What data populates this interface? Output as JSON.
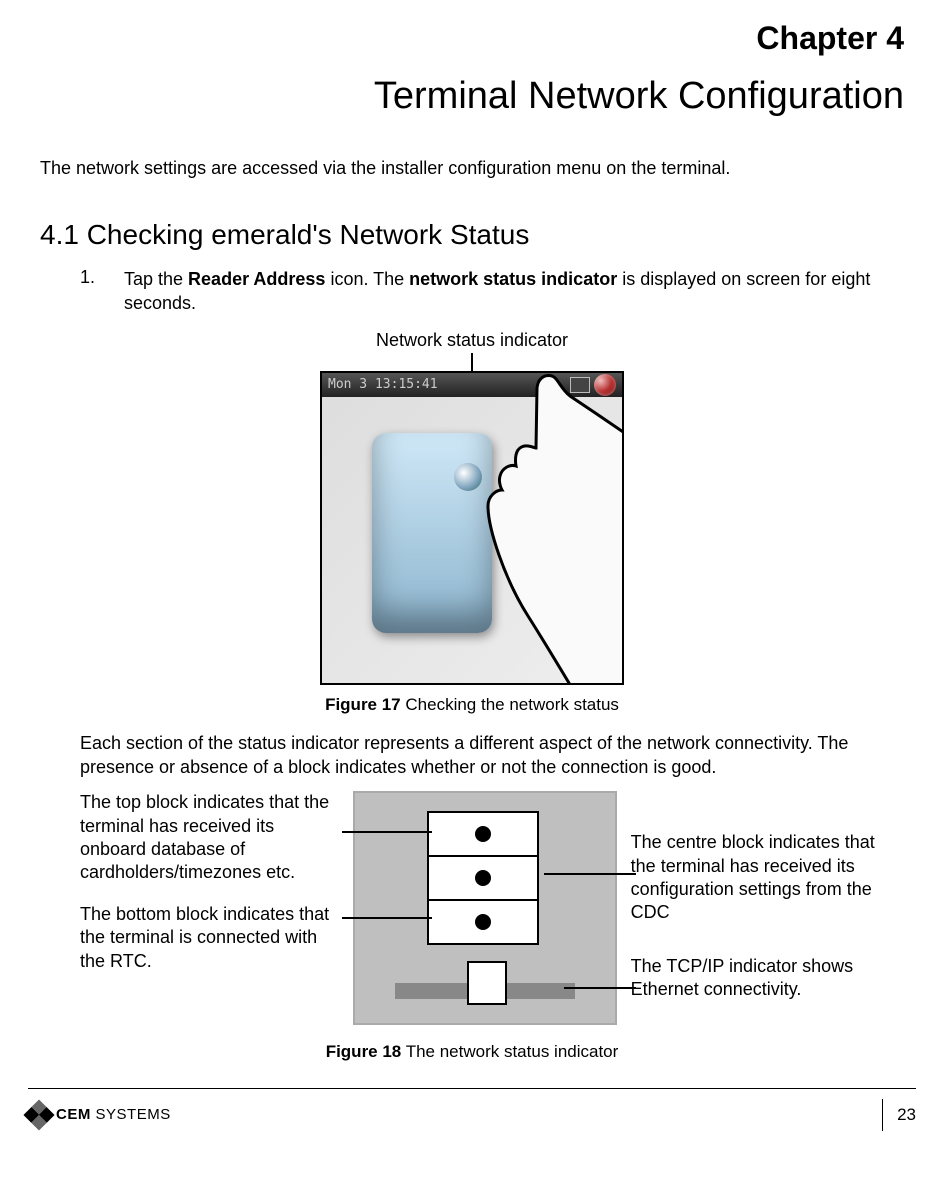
{
  "chapter_label": "Chapter 4",
  "chapter_title": "Terminal Network Configuration",
  "intro": "The network settings are accessed via the installer configuration menu on the terminal.",
  "section_heading": "4.1  Checking emerald's Network Status",
  "step1_num": "1.",
  "step1_a": "Tap the ",
  "step1_b": "Reader Address",
  "step1_c": " icon. The ",
  "step1_d": "network status indicator",
  "step1_e": " is displayed on screen for eight seconds.",
  "fig17_top_label": "Network status indicator",
  "status_time": "Mon 3   13:15:41",
  "fig17_caption_b": "Figure 17",
  "fig17_caption_t": " Checking the network status",
  "para2": "Each section of the status indicator represents a different aspect of the network connectivity. The presence or absence of a block indicates whether or not the connection is good.",
  "left_top": "The top block indicates that the terminal has received its onboard database of cardholders/timezones etc.",
  "left_bottom": "The bottom block indicates that the terminal is connected with the RTC.",
  "right_center": "The centre block indicates that the terminal has received its configuration settings from the CDC",
  "right_tcp": "The TCP/IP indicator shows Ethernet connectivity.",
  "fig18_caption_b": "Figure 18",
  "fig18_caption_t": " The network status indicator",
  "logo_cem": "CEM",
  "logo_sys": " SYSTEMS",
  "page_number": "23"
}
